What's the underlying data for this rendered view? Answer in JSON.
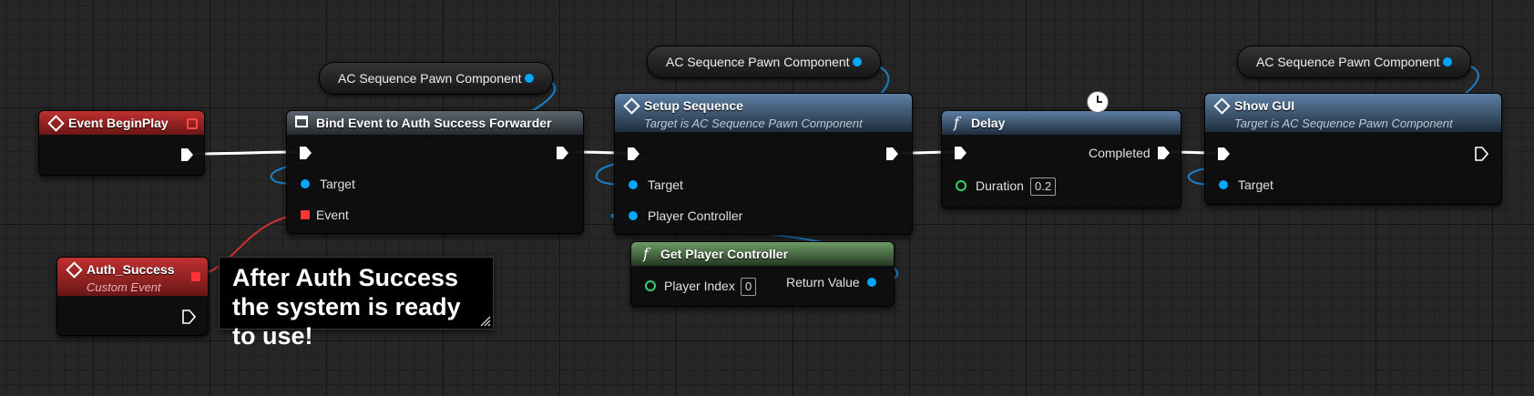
{
  "nodes": {
    "begin_play": {
      "title": "Event BeginPlay"
    },
    "auth_success": {
      "title": "Auth_Success",
      "subtitle": "Custom Event"
    },
    "bind_event": {
      "title": "Bind Event to Auth Success Forwarder",
      "pins": {
        "target": "Target",
        "event": "Event"
      }
    },
    "setup_sequence": {
      "title": "Setup Sequence",
      "subtitle": "Target is AC Sequence Pawn Component",
      "pins": {
        "target": "Target",
        "player_controller": "Player Controller"
      }
    },
    "delay": {
      "title": "Delay",
      "pins": {
        "completed": "Completed",
        "duration": "Duration"
      },
      "duration_value": "0.2"
    },
    "show_gui": {
      "title": "Show GUI",
      "subtitle": "Target is AC Sequence Pawn Component",
      "pins": {
        "target": "Target"
      }
    },
    "get_player_controller": {
      "title": "Get Player Controller",
      "pins": {
        "player_index": "Player Index",
        "return_value": "Return Value"
      },
      "player_index_value": "0"
    }
  },
  "variables": [
    {
      "label": "AC Sequence Pawn Component"
    },
    {
      "label": "AC Sequence Pawn Component"
    },
    {
      "label": "AC Sequence Pawn Component"
    }
  ],
  "comment": {
    "text": "After Auth Success the system is ready to use!"
  },
  "icons": {
    "event": "diamond-event-icon",
    "function": "function-f-icon",
    "delegate": "delegate-square-icon",
    "latent": "clock-icon"
  },
  "colors": {
    "exec_pin": "#ffffff",
    "object_pin": "#00a6ff",
    "integer_pin": "#3bd06c",
    "float_pin": "#3bd06c",
    "delegate_pin": "#ff3434",
    "event_header": "#b02a2a",
    "function_header": "#4f7196",
    "pure_function_header": "#5e8d58",
    "grid_background": "#262626"
  }
}
